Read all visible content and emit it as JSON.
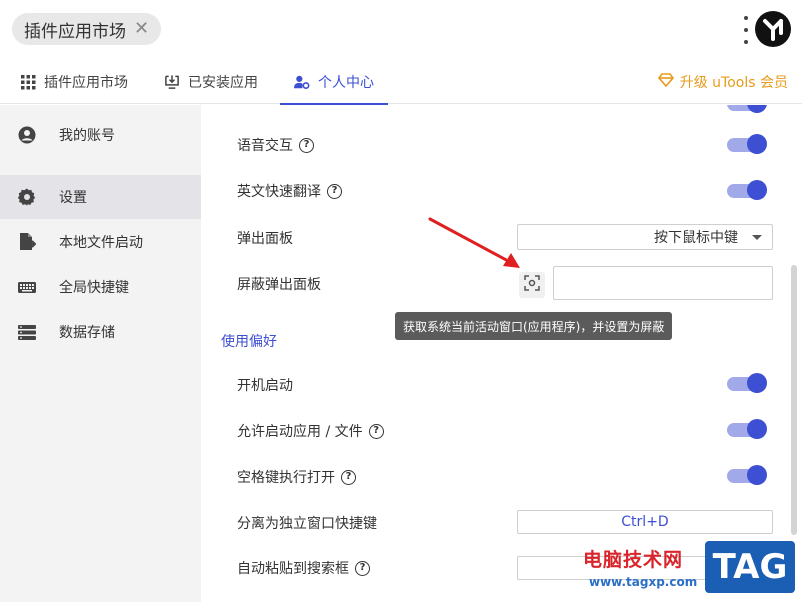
{
  "topbar": {
    "pill_text": "插件应用市场",
    "close_glyph": "✕"
  },
  "tabs": [
    {
      "label": "插件应用市场",
      "icon": "grid-icon"
    },
    {
      "label": "已安装应用",
      "icon": "download-monitor-icon"
    },
    {
      "label": "个人中心",
      "icon": "user-settings-icon",
      "active": true
    }
  ],
  "upgrade_label": "升级 uTools 会员",
  "sidebar": {
    "items": [
      {
        "label": "我的账号",
        "icon": "account-icon"
      },
      {
        "label": "设置",
        "icon": "gear-icon",
        "active": true
      },
      {
        "label": "本地文件启动",
        "icon": "file-launch-icon"
      },
      {
        "label": "全局快捷键",
        "icon": "keyboard-icon"
      },
      {
        "label": "数据存储",
        "icon": "storage-icon"
      }
    ]
  },
  "settings": {
    "voice": "语音交互",
    "translate": "英文快速翻译",
    "popup_panel": "弹出面板",
    "popup_select_value": "按下鼠标中键",
    "block_popup": "屏蔽弹出面板",
    "tooltip": "获取系统当前活动窗口(应用程序)，并设置为屏蔽",
    "section_prefs": "使用偏好",
    "autostart": "开机启动",
    "allow_launch": "允许启动应用 / 文件",
    "space_open": "空格键执行打开",
    "detach_shortcut": "分离为独立窗口快捷键",
    "detach_shortcut_value": "Ctrl+D",
    "auto_paste": "自动粘贴到搜索框",
    "help_glyph": "?"
  },
  "watermark": {
    "site_name": "电脑技术网",
    "url": "www.tagxp.com",
    "tag": "TAG"
  },
  "colors": {
    "accent": "#3d4fd3",
    "toggle_track": "#a1a9e9",
    "upgrade": "#e79b1a",
    "arrow": "#e02020"
  }
}
